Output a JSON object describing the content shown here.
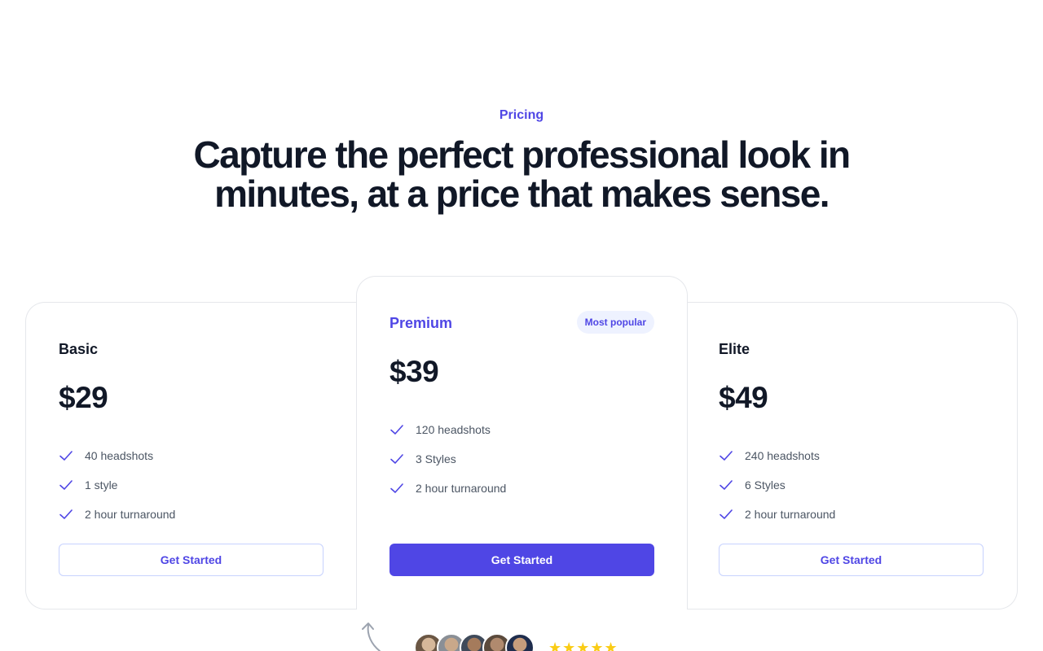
{
  "section": {
    "eyebrow": "Pricing",
    "headline": "Capture the perfect professional look in minutes, at a price that makes sense."
  },
  "plans": [
    {
      "name": "Basic",
      "price": "$29",
      "features": [
        "40 headshots",
        "1 style",
        "2 hour turnaround"
      ],
      "cta": "Get Started"
    },
    {
      "name": "Premium",
      "badge": "Most popular",
      "price": "$39",
      "features": [
        "120 headshots",
        "3 Styles",
        "2 hour turnaround"
      ],
      "cta": "Get Started"
    },
    {
      "name": "Elite",
      "price": "$49",
      "features": [
        "240 headshots",
        "6 Styles",
        "2 hour turnaround"
      ],
      "cta": "Get Started"
    }
  ],
  "social_proof": {
    "rating_stars": 5,
    "stars": "★★★★★",
    "avatar_count": 5
  },
  "colors": {
    "accent": "#4f46e5",
    "text_dark": "#111827",
    "text_muted": "#4b5563",
    "border": "#e5e7eb",
    "badge_bg": "#eef2ff",
    "star": "#facc15"
  },
  "icons": {
    "feature": "check-icon",
    "decor": "curved-arrow-icon"
  }
}
